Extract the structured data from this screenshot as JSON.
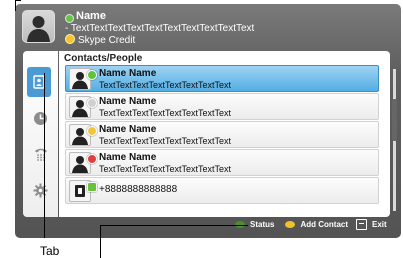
{
  "profile": {
    "name": "Name",
    "mood_text": "- TextTextTextTextTextTextTextTextTextText",
    "credit_label": "Skype Credit",
    "status_color": "#69c346"
  },
  "sidebar": {
    "tabs": [
      {
        "icon": "contacts-icon",
        "active": true
      },
      {
        "icon": "clock-icon",
        "active": false
      },
      {
        "icon": "dialpad-icon",
        "active": false
      },
      {
        "icon": "gear-icon",
        "active": false
      }
    ]
  },
  "content": {
    "title": "Contacts/People",
    "rows": [
      {
        "name": "Name Name",
        "sub": "TextTextTextTextTextTextTextText",
        "status": "online",
        "status_color": "#5fc33b",
        "selected": true
      },
      {
        "name": "Name Name",
        "sub": "TextTextTextTextTextTextTextText",
        "status": "offline",
        "status_color": "#d0d0d0",
        "selected": false
      },
      {
        "name": "Name Name",
        "sub": "TextTextTextTextTextTextTextText",
        "status": "away",
        "status_color": "#f2c63c",
        "selected": false
      },
      {
        "name": "Name Name",
        "sub": "TextTextTextTextTextTextTextText",
        "status": "busy",
        "status_color": "#e04040",
        "selected": false
      },
      {
        "number": "+8888888888888",
        "status_color": "#6ac23b",
        "selected": false
      }
    ]
  },
  "hints": {
    "status_label": "Status",
    "status_color": "#4b8f2b",
    "add_contact_label": "Add Contact",
    "add_contact_color": "#efc12b",
    "exit_label": "Exit"
  },
  "annotations": {
    "tab_label": "Tab"
  }
}
